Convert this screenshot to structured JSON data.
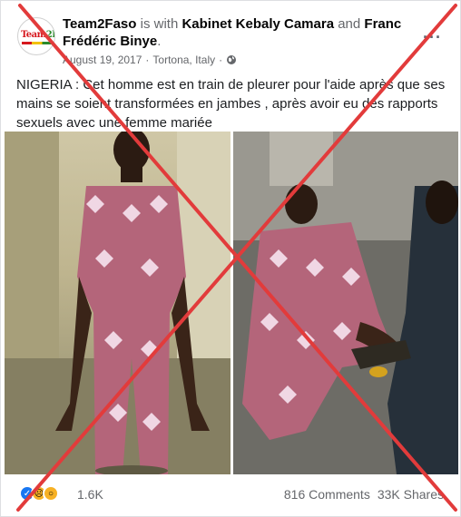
{
  "post": {
    "author": "Team2Faso",
    "with_text": "is with",
    "tagged_1": "Kabinet Kebaly Camara",
    "and_text": "and",
    "tagged_2": "Franc Frédéric Binye",
    "date": "August 19, 2017",
    "location": "Tortona, Italy",
    "more_label": "···",
    "body": "NIGERIA : Cet homme est en train de pleurer pour l'aide après que ses mains se soient transformées en jambes , après avoir eu des rapports sexuels avec une femme mariée",
    "avatar_logo_part1": "Team",
    "avatar_logo_part2": "2Faso"
  },
  "footer": {
    "reaction_count": "1.6K",
    "comments": "816 Comments",
    "shares": "33K Shares"
  },
  "colors": {
    "cross": "#e23b3b",
    "link_blue": "#1877f2",
    "meta_gray": "#65676b"
  }
}
